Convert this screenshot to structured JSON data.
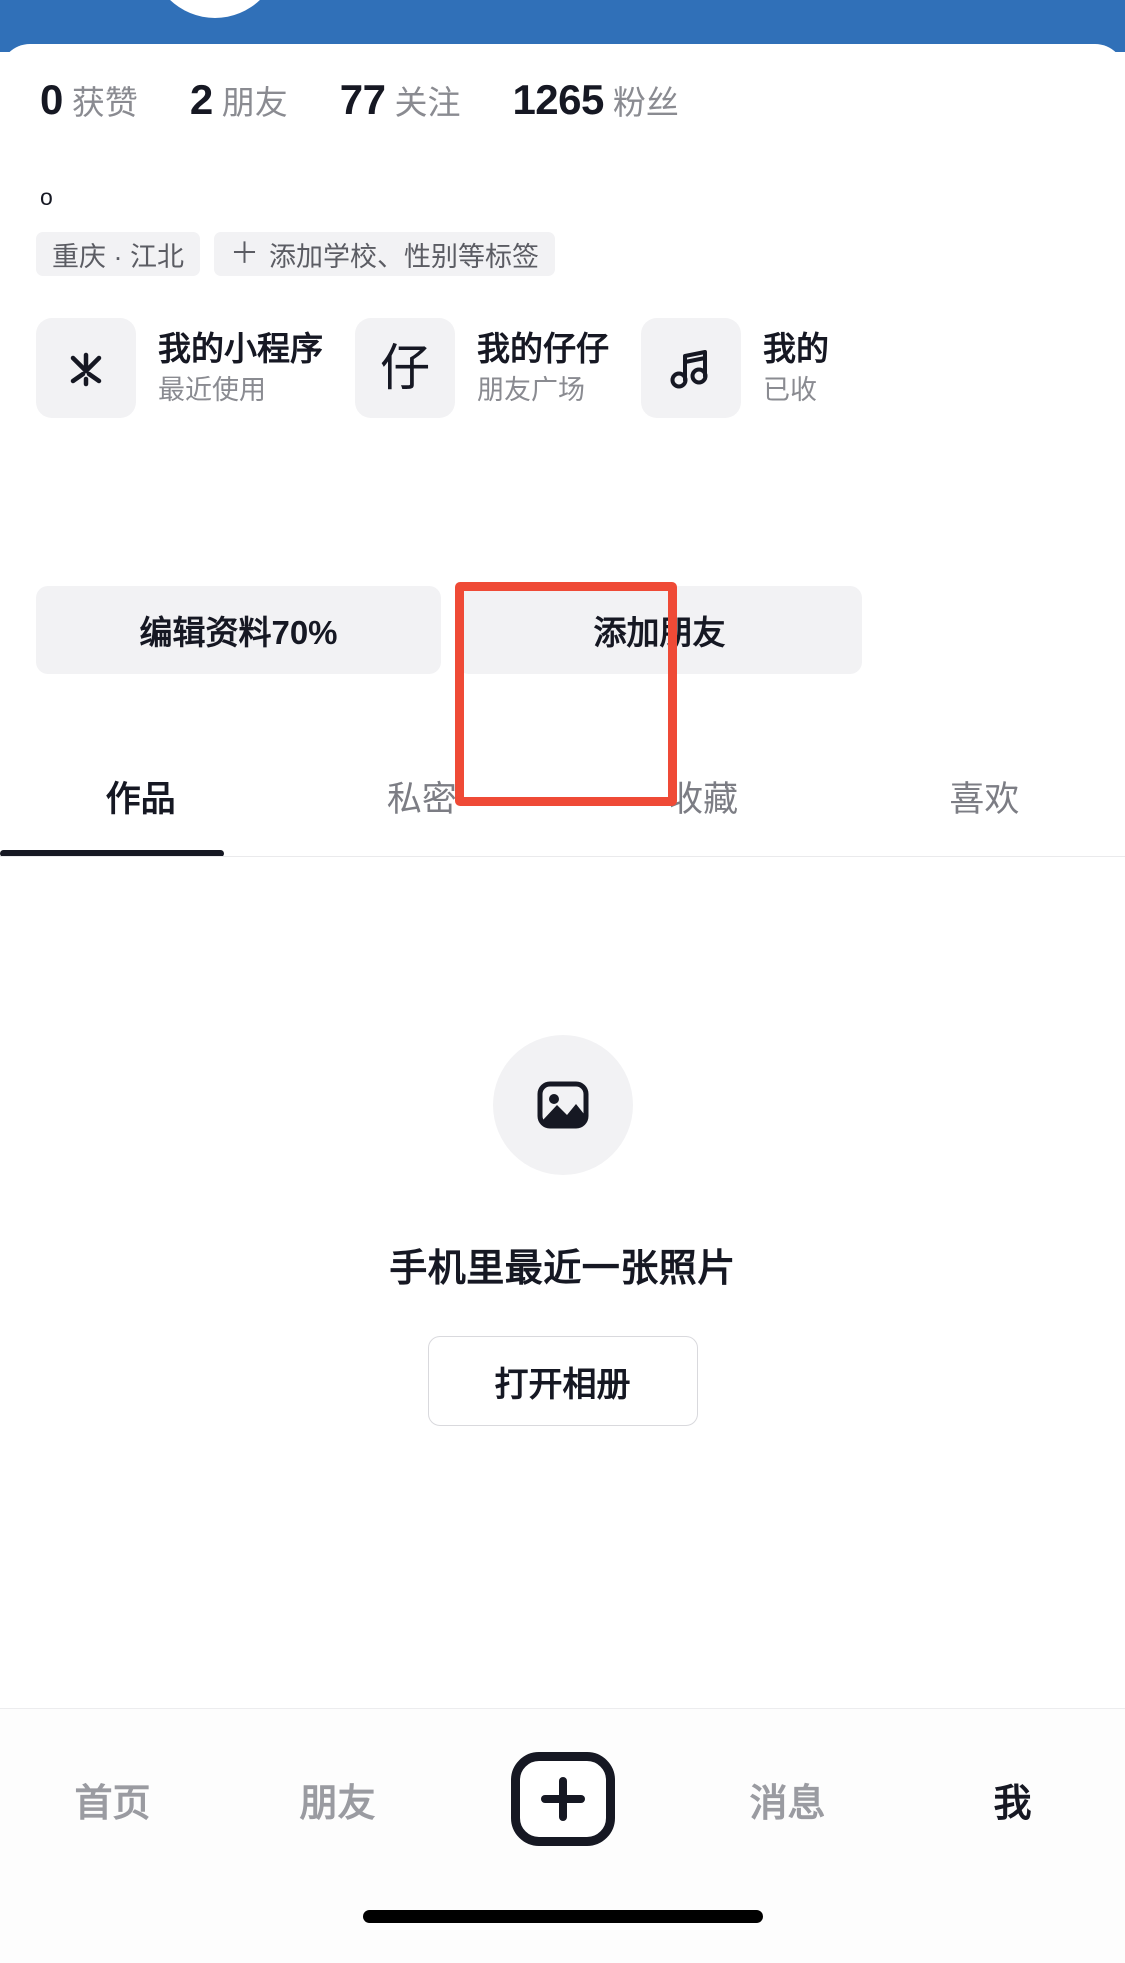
{
  "theme": {
    "header_blue": "#3070b8",
    "text_primary": "#161823",
    "text_secondary": "#8a8b91",
    "chip_bg": "#f2f2f4",
    "highlight_red": "#ef4a36"
  },
  "profile": {
    "stats": [
      {
        "value": "0",
        "label": "获赞"
      },
      {
        "value": "2",
        "label": "朋友"
      },
      {
        "value": "77",
        "label": "关注"
      },
      {
        "value": "1265",
        "label": "粉丝"
      }
    ],
    "signature": "o",
    "tags": [
      {
        "text": "重庆 · 江北",
        "has_plus": false
      },
      {
        "text": "添加学校、性别等标签",
        "has_plus": true,
        "plus": "＋"
      }
    ]
  },
  "cards": [
    {
      "icon": "asterisk-icon",
      "title": "我的小程序",
      "subtitle": "最近使用"
    },
    {
      "icon": "zai-character-icon",
      "glyph": "仔",
      "title": "我的仔仔",
      "subtitle": "朋友广场"
    },
    {
      "icon": "music-note-icon",
      "title": "我的",
      "subtitle": "已收"
    }
  ],
  "actions": [
    {
      "label": "编辑资料70%"
    },
    {
      "label": "添加朋友"
    }
  ],
  "content_tabs": [
    {
      "label": "作品",
      "active": true
    },
    {
      "label": "私密",
      "active": false
    },
    {
      "label": "收藏",
      "active": false,
      "highlighted": true
    },
    {
      "label": "喜欢",
      "active": false
    }
  ],
  "empty_state": {
    "icon": "photo-image-icon",
    "title": "手机里最近一张照片",
    "button_label": "打开相册"
  },
  "bottom_nav": [
    {
      "label": "首页",
      "active": false,
      "type": "text"
    },
    {
      "label": "朋友",
      "active": false,
      "type": "text"
    },
    {
      "label": "",
      "active": false,
      "type": "plus"
    },
    {
      "label": "消息",
      "active": false,
      "type": "text"
    },
    {
      "label": "我",
      "active": true,
      "type": "text"
    }
  ]
}
